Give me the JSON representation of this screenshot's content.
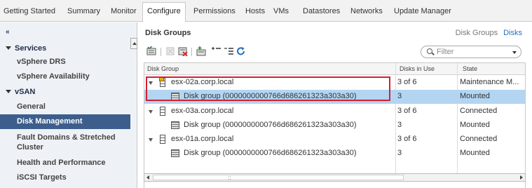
{
  "tabs": [
    "Getting Started",
    "Summary",
    "Monitor",
    "Configure",
    "Permissions",
    "Hosts",
    "VMs",
    "Datastores",
    "Networks",
    "Update Manager"
  ],
  "active_tab": "Configure",
  "sidebar": {
    "collapse_glyph": "«",
    "items": [
      {
        "label": "Services"
      },
      {
        "label": "vSphere DRS"
      },
      {
        "label": "vSphere Availability"
      },
      {
        "label": "vSAN"
      },
      {
        "label": "General"
      },
      {
        "label": "Disk Management"
      },
      {
        "label": "Fault Domains & Stretched Cluster"
      },
      {
        "label": "Health and Performance"
      },
      {
        "label": "iSCSI Targets"
      }
    ],
    "selected": "Disk Management"
  },
  "main": {
    "title": "Disk Groups",
    "sublinks": [
      "Disk Groups",
      "Disks"
    ],
    "active_sublink": "Disks",
    "filter_placeholder": "Filter",
    "toolbar_icons": [
      "claim-disks-icon",
      "remove-disks-icon",
      "remove-disk-group-icon",
      "create-disk-group-icon",
      "expand-all-icon",
      "collapse-all-icon",
      "refresh-icon"
    ]
  },
  "grid": {
    "columns": [
      "Disk Group",
      "Disks in Use",
      "State"
    ],
    "rows": [
      {
        "name": "esx-02a.corp.local",
        "disks": "3 of 6",
        "state": "Maintenance M..."
      },
      {
        "name": "Disk group (0000000000766d686261323a303a30)",
        "disks": "3",
        "state": "Mounted"
      },
      {
        "name": "esx-03a.corp.local",
        "disks": "3 of 6",
        "state": "Connected"
      },
      {
        "name": "Disk group (0000000000766d686261323a303a30)",
        "disks": "3",
        "state": "Mounted"
      },
      {
        "name": "esx-01a.corp.local",
        "disks": "3 of 6",
        "state": "Connected"
      },
      {
        "name": "Disk group (0000000000766d686261323a303a30)",
        "disks": "3",
        "state": "Mounted"
      }
    ],
    "selected_row": 1,
    "scroll_grip": "::"
  },
  "colors": {
    "accent": "#3d5e8c",
    "selection": "#b3d5f2",
    "highlight_border": "#d42030",
    "link": "#2a6ebb"
  }
}
